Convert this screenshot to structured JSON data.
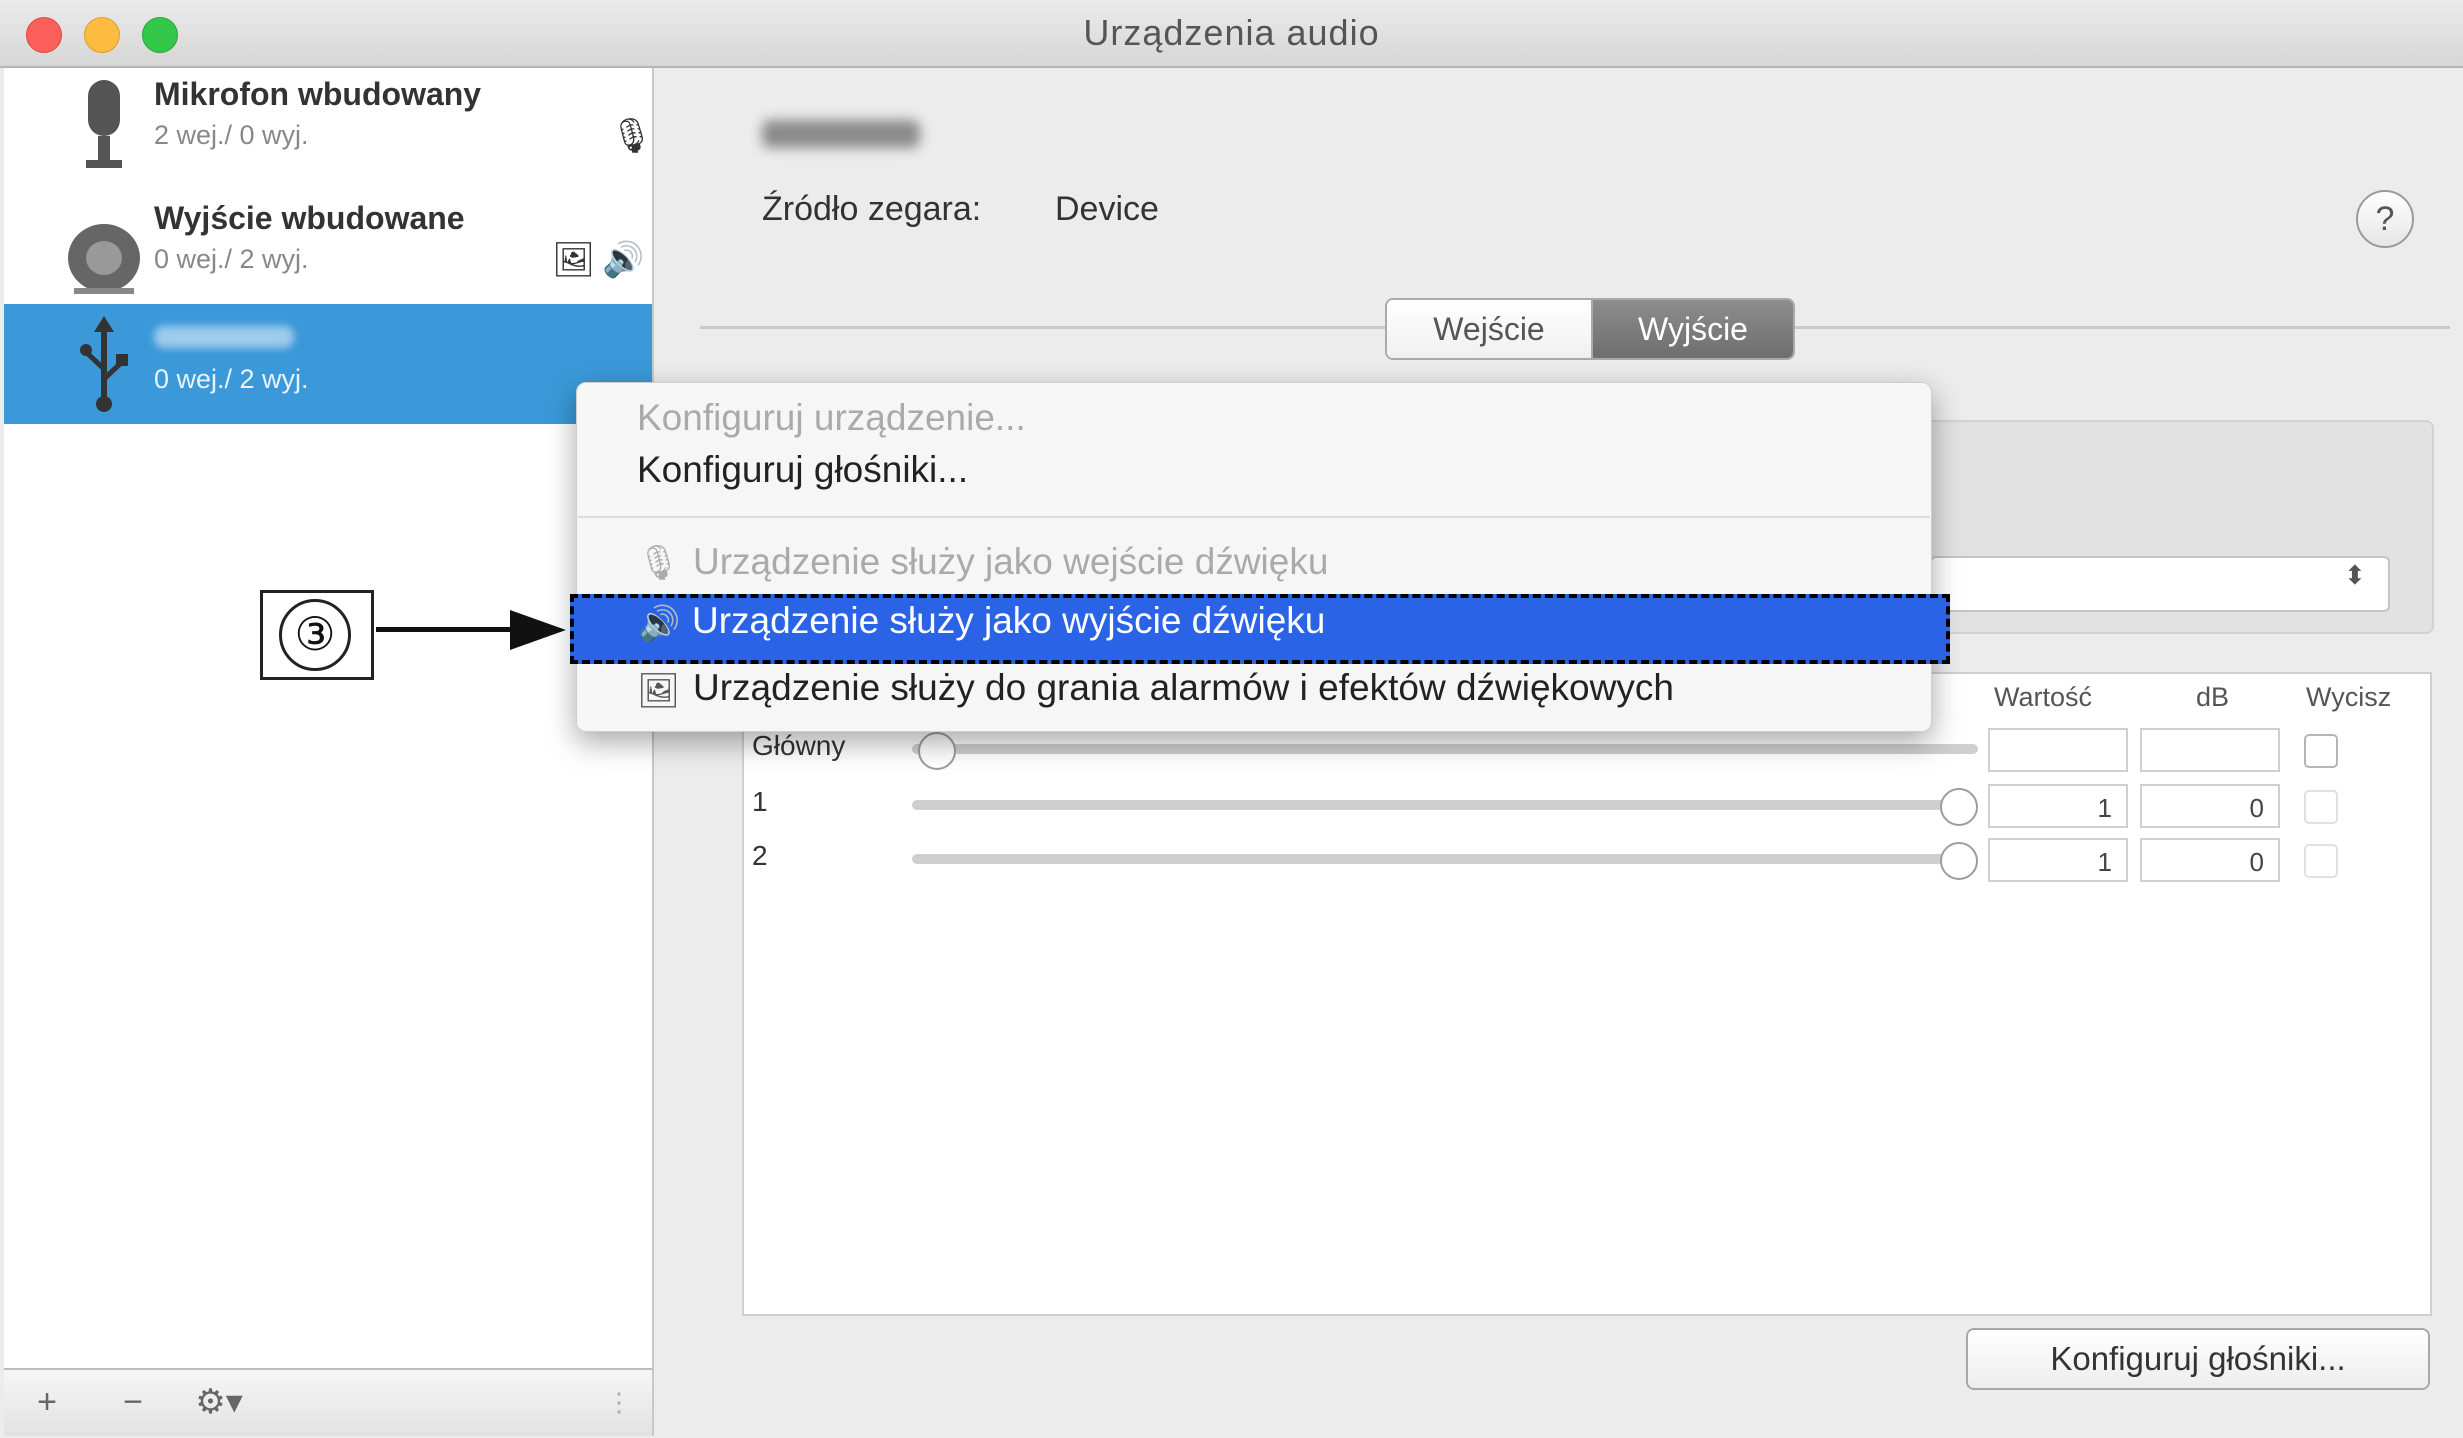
{
  "window": {
    "title": "Urządzenia audio",
    "traffic_lights": [
      "close",
      "minimize",
      "maximize"
    ]
  },
  "sidebar": {
    "devices": [
      {
        "name": "Mikrofon wbudowany",
        "io": "2 wej./ 0 wyj.",
        "icon": "microphone-icon",
        "flags": [
          "🎙"
        ]
      },
      {
        "name": "Wyjście wbudowane",
        "io": "0 wej./ 2 wyj.",
        "icon": "speaker-icon",
        "flags": [
          "🖼",
          "🔊"
        ]
      },
      {
        "name": "",
        "io": "0 wej./ 2 wyj.",
        "icon": "usb-icon",
        "selected": true
      }
    ],
    "bar": {
      "add": "+",
      "remove": "−",
      "gear": "⚙▾"
    }
  },
  "main": {
    "clock_label": "Źródło zegara:",
    "clock_value": "Device",
    "help": "?",
    "tabs": [
      {
        "label": "Wejście",
        "active": false
      },
      {
        "label": "Wyjście",
        "active": true
      }
    ],
    "table": {
      "headers": {
        "value": "Wartość",
        "db": "dB",
        "mute": "Wycisz"
      },
      "rows": [
        {
          "label": "Główny",
          "value": "",
          "db": "",
          "slider_level": 0.0
        },
        {
          "label": "1",
          "value": "1",
          "db": "0",
          "slider_level": 1.0
        },
        {
          "label": "2",
          "value": "1",
          "db": "0",
          "slider_level": 1.0
        }
      ]
    },
    "configure_button": "Konfiguruj głośniki..."
  },
  "menu": {
    "items": [
      {
        "label": "Konfiguruj urządzenie...",
        "enabled": false
      },
      {
        "label": "Konfiguruj głośniki...",
        "enabled": true
      },
      {
        "label": "Urządzenie służy jako wejście dźwięku",
        "enabled": false,
        "icon": "🎙"
      },
      {
        "label": "Urządzenie służy jako wyjście dźwięku",
        "enabled": true,
        "highlighted": true,
        "icon": "🔊"
      },
      {
        "label": "Urządzenie służy do grania alarmów i efektów dźwiękowych",
        "enabled": true,
        "icon": "🖼"
      }
    ]
  },
  "callout": {
    "number": "③"
  },
  "colors": {
    "selection": "#3b99d9",
    "menu_highlight": "#2b63e6"
  }
}
